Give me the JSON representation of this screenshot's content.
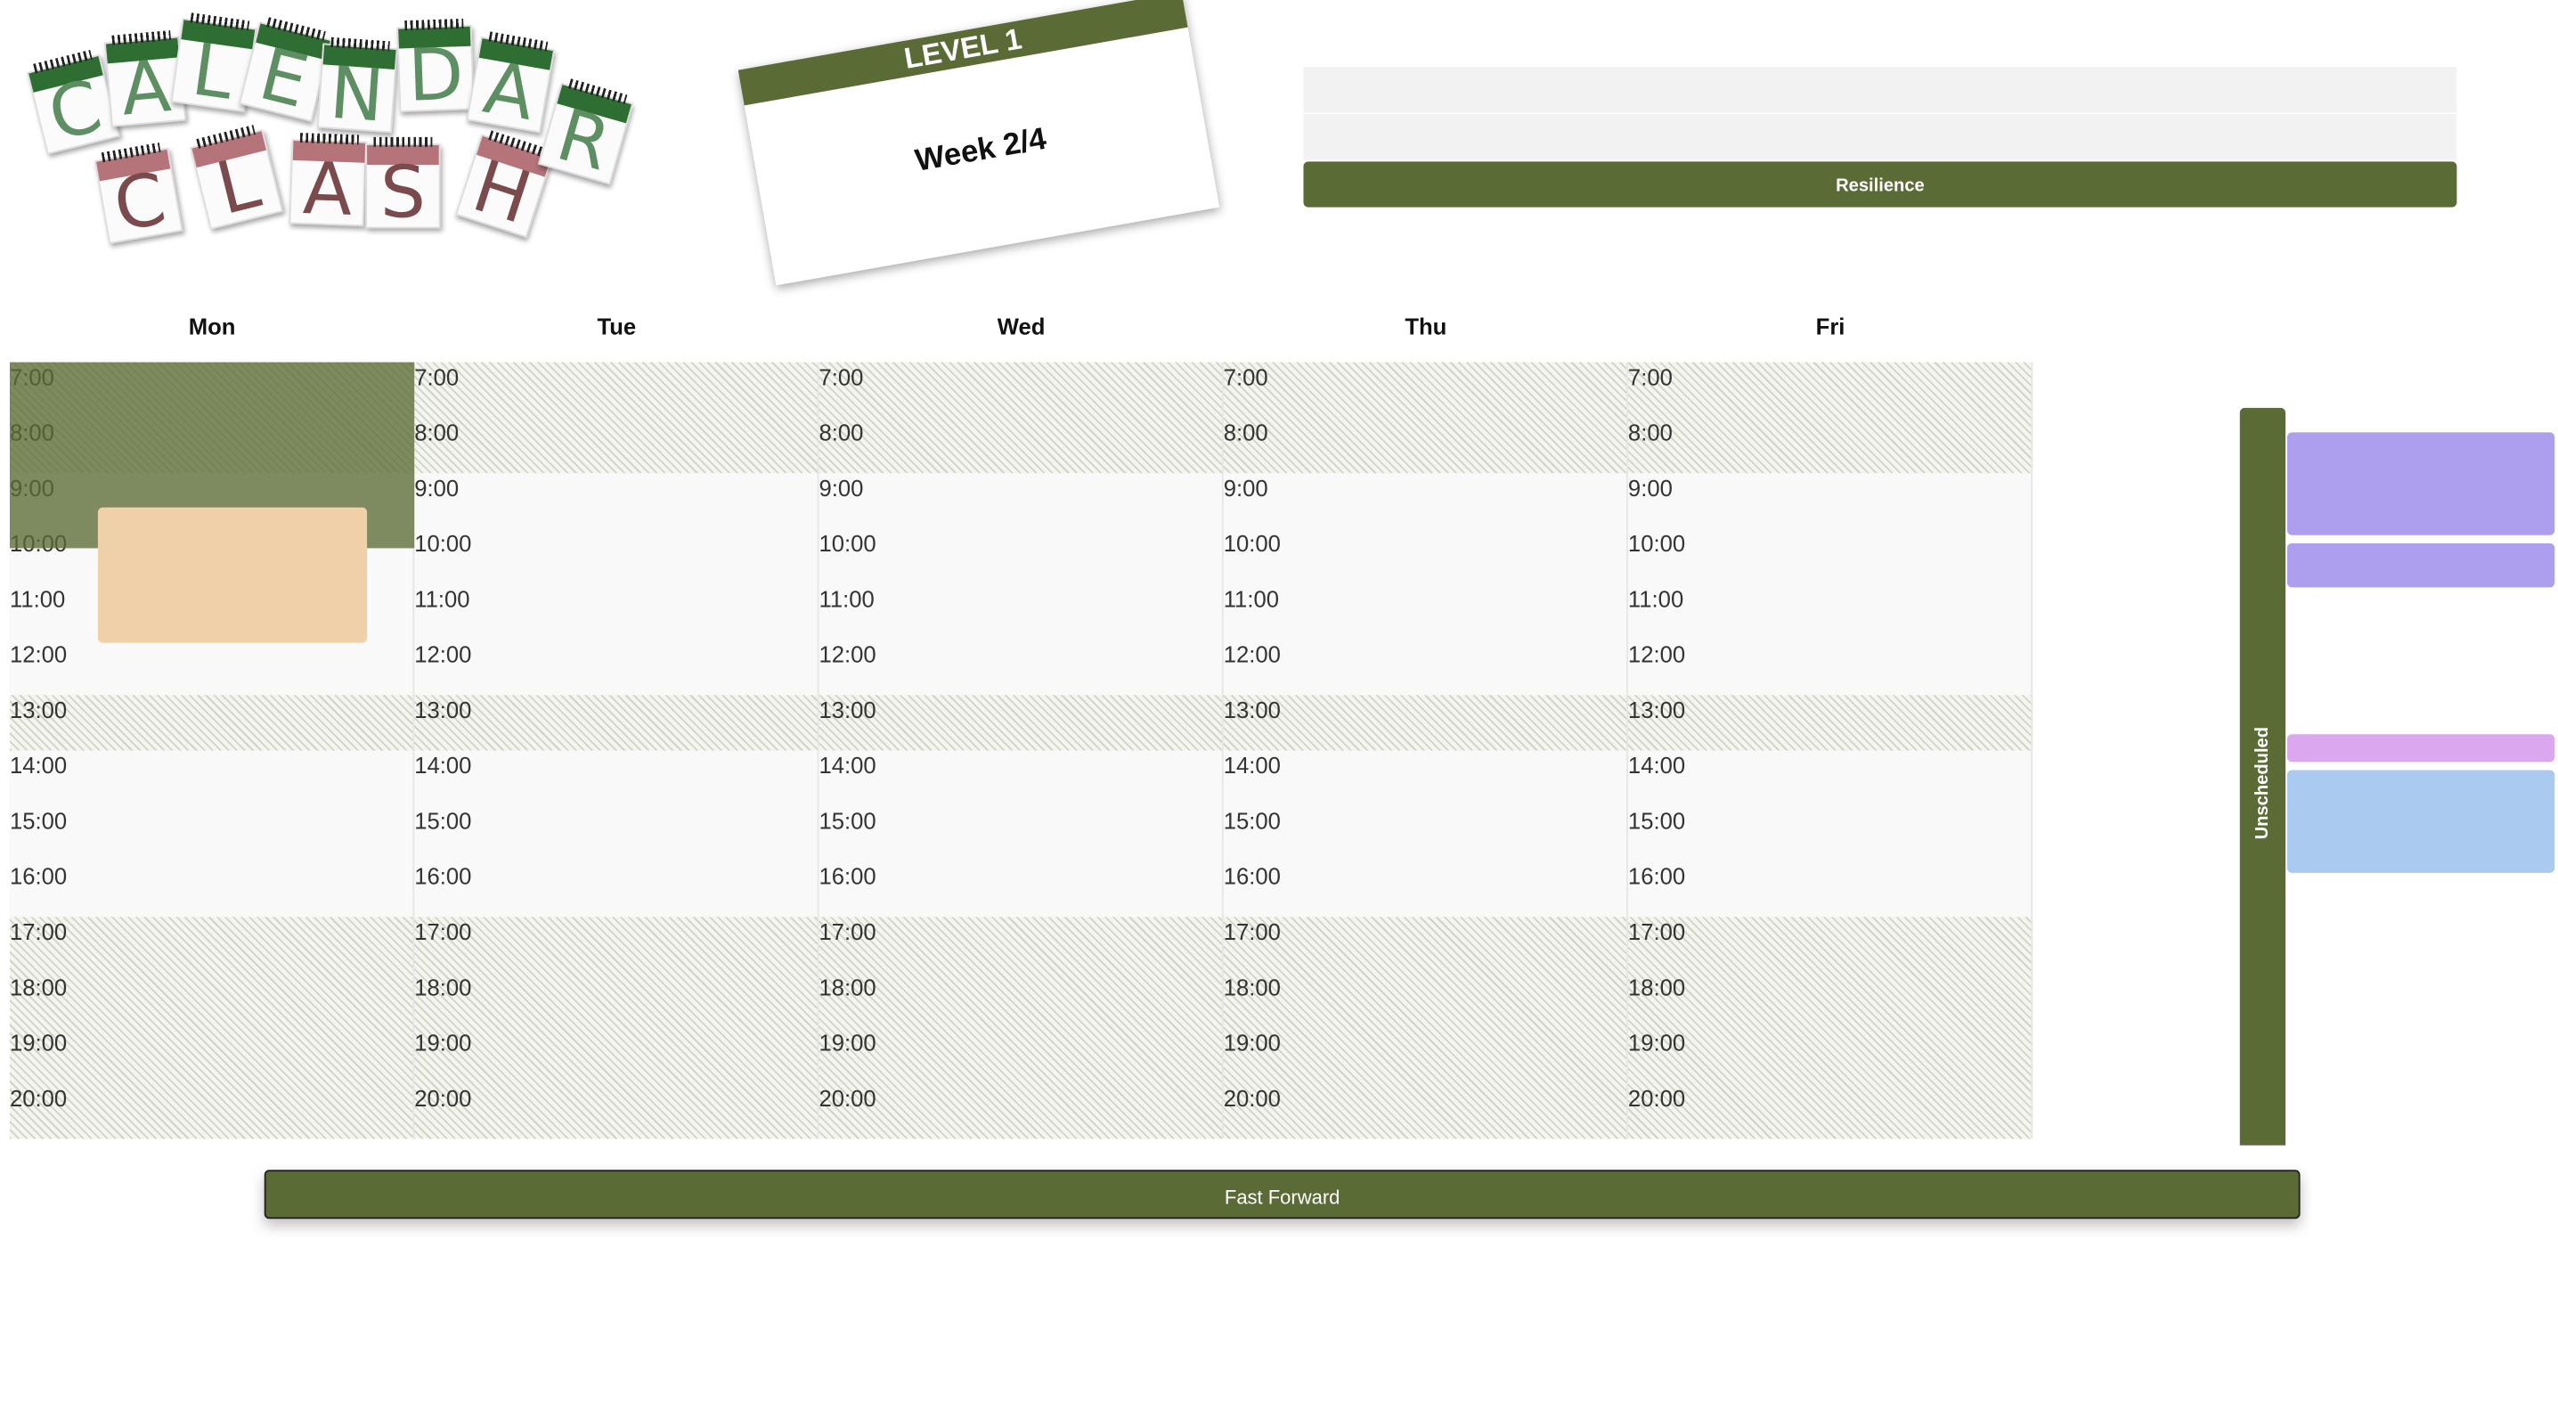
{
  "logo": {
    "title": "CALENDAR CLASH",
    "top_letters": [
      "C",
      "A",
      "L",
      "E",
      "N",
      "D",
      "A",
      "R"
    ],
    "bottom_letters": [
      "C",
      "L",
      "A",
      "S",
      "H"
    ],
    "colors": {
      "green_band": "#2f6e33",
      "green_letter": "#5d8f62",
      "red_band": "#b5737a",
      "red_letter": "#7a4a4c"
    }
  },
  "level_card": {
    "level_label": "LEVEL 1",
    "week_label": "Week 2/4"
  },
  "resilience": {
    "label": "Resilience"
  },
  "calendar": {
    "days": [
      "Mon",
      "Tue",
      "Wed",
      "Thu",
      "Fri"
    ],
    "time_slots": [
      "7:00",
      "8:00",
      "9:00",
      "10:00",
      "11:00",
      "12:00",
      "13:00",
      "14:00",
      "15:00",
      "16:00",
      "17:00",
      "18:00",
      "19:00",
      "20:00"
    ],
    "unavailable_periods": [
      "7:00-9:00",
      "13:00-14:00",
      "17:00-21:00"
    ],
    "scheduled_event_color": "#efd0a8",
    "blocked_color": "#5b6b35"
  },
  "unscheduled": {
    "label": "Unscheduled",
    "task_colors": [
      "#ae9fee",
      "#ae9fee",
      "#dba8ef",
      "#abcaf0"
    ]
  },
  "fast_forward": {
    "label": "Fast Forward"
  },
  "colors": {
    "accent": "#5b6b35"
  }
}
